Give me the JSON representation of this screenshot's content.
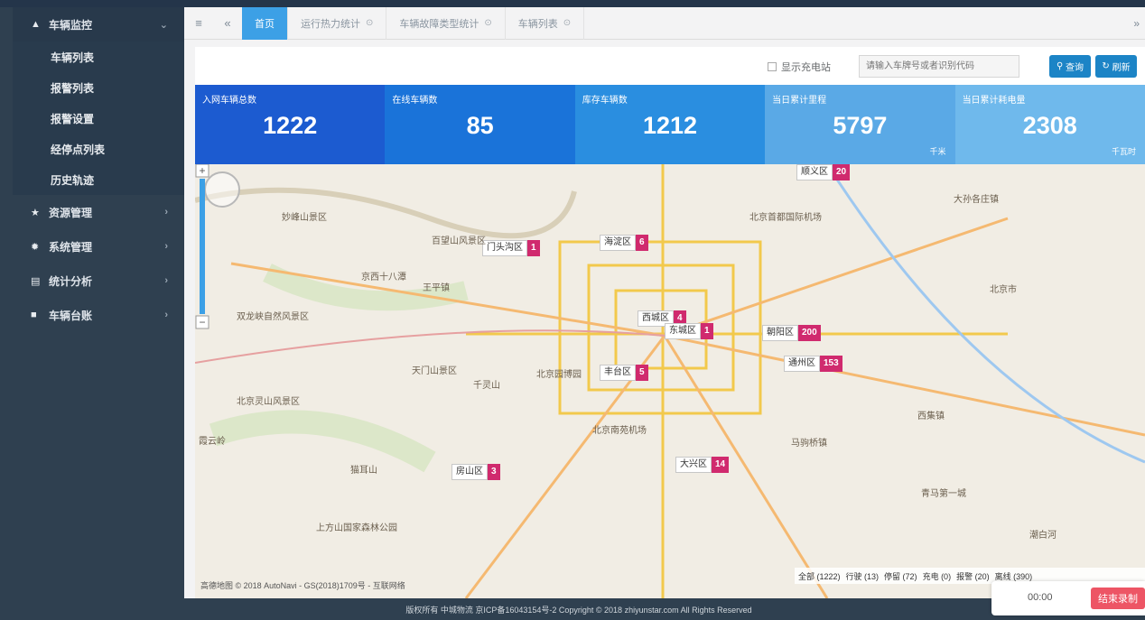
{
  "sidebar": {
    "groups": [
      {
        "label": "车辆监控",
        "icon": "bell-icon",
        "items": [
          "车辆列表",
          "报警列表",
          "报警设置",
          "经停点列表",
          "历史轨迹"
        ]
      },
      {
        "label": "资源管理",
        "icon": "star-icon"
      },
      {
        "label": "系统管理",
        "icon": "gear-icon"
      },
      {
        "label": "统计分析",
        "icon": "bar-chart-icon"
      },
      {
        "label": "车辆台账",
        "icon": "book-icon"
      }
    ]
  },
  "tabs": [
    {
      "label": "首页"
    },
    {
      "label": "运行热力统计"
    },
    {
      "label": "车辆故障类型统计"
    },
    {
      "label": "车辆列表"
    }
  ],
  "filters": {
    "checkbox_label": "显示充电站",
    "search_placeholder": "请输入车牌号或者识别代码",
    "query_label": "查询",
    "refresh_label": "刷新"
  },
  "stats": [
    {
      "label": "入网车辆总数",
      "value": "1222",
      "unit": "",
      "color": "#1c5bd0"
    },
    {
      "label": "在线车辆数",
      "value": "85",
      "unit": "",
      "color": "#1a73d9"
    },
    {
      "label": "库存车辆数",
      "value": "1212",
      "unit": "",
      "color": "#2a8ee0"
    },
    {
      "label": "当日累计里程",
      "value": "5797",
      "unit": "千米",
      "color": "#5aa9e6"
    },
    {
      "label": "当日累计耗电量",
      "value": "2308",
      "unit": "千瓦时",
      "color": "#6fb9ec"
    }
  ],
  "map": {
    "markers": [
      {
        "name": "顺义区",
        "count": "20"
      },
      {
        "name": "门头沟区",
        "count": "1"
      },
      {
        "name": "海淀区",
        "count": "6"
      },
      {
        "name": "西城区",
        "count": "4"
      },
      {
        "name": "东城区",
        "count": "1"
      },
      {
        "name": "朝阳区",
        "count": "200"
      },
      {
        "name": "通州区",
        "count": "153"
      },
      {
        "name": "丰台区",
        "count": "5"
      },
      {
        "name": "大兴区",
        "count": "14"
      },
      {
        "name": "房山区",
        "count": "3"
      }
    ],
    "places": [
      "北京首都国际机场",
      "妙峰山景区",
      "百望山风景区",
      "京西十八潭",
      "王平镇",
      "双龙峡自然风景区",
      "天门山景区",
      "千灵山",
      "北京园博园",
      "北京灵山风景区",
      "北京南苑机场",
      "霞云岭",
      "猫耳山",
      "上方山国家森林公园",
      "青马第一城",
      "潮白河",
      "大孙各庄镇",
      "北京市",
      "西集镇",
      "马驹桥镇"
    ],
    "legend": [
      "全部 (1222)",
      "行驶 (13)",
      "停留 (72)",
      "充电 (0)",
      "报警 (20)",
      "离线 (390)"
    ],
    "attribution": "高德地图 © 2018 AutoNavi - GS(2018)1709号 - 互联网络"
  },
  "recorder": {
    "time": "00:00",
    "stop_label": "结束录制"
  },
  "footer": "版权所有 中城物流  京ICP备16043154号-2  Copyright © 2018 zhiyunstar.com All Rights Reserved"
}
